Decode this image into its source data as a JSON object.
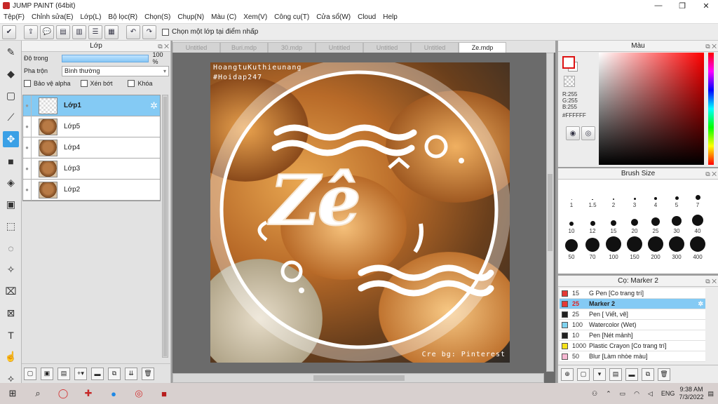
{
  "window": {
    "title": "JUMP PAINT (64bit)"
  },
  "menu": [
    "Tệp(F)",
    "Chỉnh sửa(E)",
    "Lớp(L)",
    "Bộ lọc(R)",
    "Chọn(S)",
    "Chụp(N)",
    "Màu (C)",
    "Xem(V)",
    "Công cụ(T)",
    "Cửa sổ(W)",
    "Cloud",
    "Help"
  ],
  "toolbar": {
    "pick_layer_label": "Chọn một lớp tại điểm nhấp"
  },
  "layer_panel": {
    "title": "Lớp",
    "opacity_label": "Độ trong",
    "opacity_value": "100 %",
    "opacity_fraction": 1.0,
    "blend_label": "Pha trộn",
    "blend_value": "Bình thường",
    "protect_alpha": "Bảo vệ alpha",
    "clipping": "Xén bớt",
    "lock": "Khóa",
    "layers": [
      "Lớp1",
      "Lớp5",
      "Lớp4",
      "Lớp3",
      "Lớp2"
    ]
  },
  "tabs": [
    "Untitled",
    "Buri.mdp",
    "30.mdp",
    "Untitled",
    "Untitled",
    "Untitled",
    "Ze.mdp"
  ],
  "canvas": {
    "watermark_top_1": "HoangtuKuthieunang",
    "watermark_top_2": "#Hoidap247",
    "watermark_bottom": "Cre bg: Pinterest",
    "logo_text": "Zê"
  },
  "color_panel": {
    "title": "Màu",
    "r": "R:255",
    "g": "G:255",
    "b": "B:255",
    "hex": "#FFFFFF"
  },
  "brush_panel": {
    "title": "Brush Size",
    "sizes": [
      "1",
      "1.5",
      "2",
      "3",
      "4",
      "5",
      "7",
      "10",
      "12",
      "15",
      "20",
      "25",
      "30",
      "40",
      "50",
      "70",
      "100",
      "150",
      "200",
      "300",
      "400"
    ]
  },
  "marker_panel": {
    "title": "Cọ: Marker 2",
    "items": [
      {
        "size": "15",
        "name": "G Pen [Co trang trí]",
        "color": "#e53935"
      },
      {
        "size": "25",
        "name": "Marker 2",
        "color": "#e53935"
      },
      {
        "size": "25",
        "name": "Pen [ Viết, vẽ]",
        "color": "#222222"
      },
      {
        "size": "100",
        "name": "Watercolor (Wet)",
        "color": "#7fd3f0"
      },
      {
        "size": "10",
        "name": "Pen [Nét mảnh]",
        "color": "#222222"
      },
      {
        "size": "1000",
        "name": "Plastic Crayon [Co trang trí]",
        "color": "#f5e21b"
      },
      {
        "size": "50",
        "name": "Blur [Làm nhòe màu]",
        "color": "#f7b8d3"
      }
    ]
  },
  "taskbar": {
    "lang": "ENG",
    "time": "9:38 AM",
    "date": "7/3/2022"
  }
}
